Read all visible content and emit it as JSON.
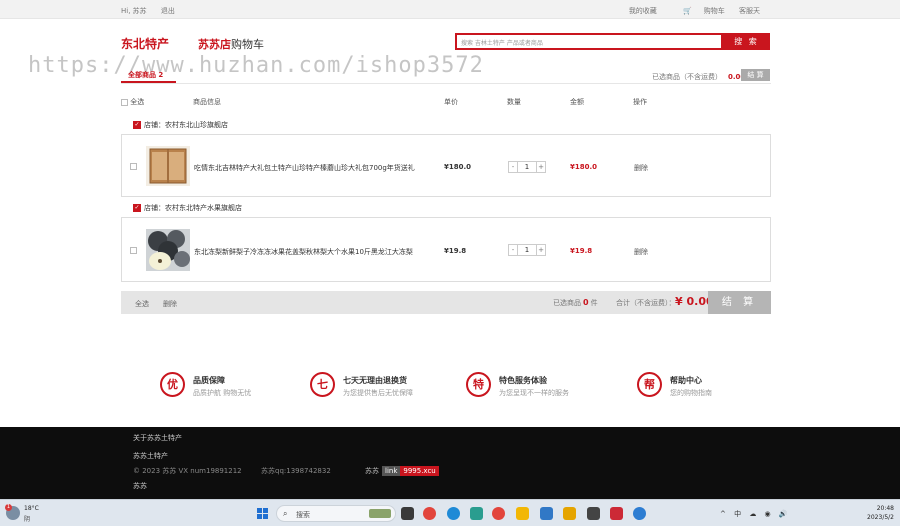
{
  "topbar": {
    "left": [
      "Hi, 苏苏",
      "退出"
    ],
    "right": [
      "我的收藏",
      "购物车",
      "客服天"
    ],
    "cart_icon": "cart-icon"
  },
  "header": {
    "logo_main": "东北特产",
    "logo_shop_bold": "苏苏店",
    "logo_shop_rest": "购物车",
    "search_placeholder": "搜索 吉林土特产 产品或者商品",
    "search_button": "搜 索"
  },
  "watermark": "https://www.huzhan.com/ishop3572",
  "cart": {
    "all_tab": "全部商品 2",
    "selected_label": "已选商品（不含运费）",
    "selected_amount": "0.00",
    "pay_small": "结 算",
    "columns": [
      "全选",
      "商品信息",
      "单价",
      "数量",
      "金额",
      "操作"
    ],
    "shops": [
      {
        "shop_label": "店铺：",
        "shop_name": "农村东北山珍旗舰店",
        "item": {
          "name": "吃情东北吉林特产大礼包土特产山珍特产榛蘑山珍大礼包700g年货送礼",
          "price": "¥180.0",
          "qty_minus": "-",
          "qty": "1",
          "qty_plus": "+",
          "subtotal": "¥180.0",
          "delete": "删除"
        }
      },
      {
        "shop_label": "店铺：",
        "shop_name": "农村东北特产水果旗舰店",
        "item": {
          "name": "东北冻梨新鲜梨子冷冻冻冰果花盖梨秋林梨大个水果10斤黑龙江大冻梨",
          "price": "¥19.8",
          "qty_minus": "-",
          "qty": "1",
          "qty_plus": "+",
          "subtotal": "¥19.8",
          "delete": "删除"
        }
      }
    ],
    "summary": {
      "select_all": "全选",
      "delete": "删除",
      "selected_prefix": "已选商品",
      "selected_count": "0",
      "selected_suffix": "件",
      "total_label": "合计（不含运费）：",
      "total": "¥ 0.00",
      "checkout": "结 算"
    }
  },
  "services": [
    {
      "icon": "优",
      "title": "品质保障",
      "sub": "品质护航 购物无忧"
    },
    {
      "icon": "七",
      "title": "七天无理由退换货",
      "sub": "为您提供售后无忧保障"
    },
    {
      "icon": "特",
      "title": "特色服务体验",
      "sub": "为您呈现不一样的服务"
    },
    {
      "icon": "帮",
      "title": "帮助中心",
      "sub": "您的购物指南"
    }
  ],
  "footer": {
    "line1": "关于苏苏土特产",
    "line2": "苏苏土特产",
    "copyright": "© 2023 苏苏 VX num19891212",
    "qq": "苏苏qq:1398742832",
    "link_prefix": "苏苏",
    "badge1": "link",
    "badge2": "9995.xcu",
    "line4": "苏苏"
  },
  "taskbar": {
    "temp": "18°C",
    "weather": "阴",
    "notify": "1",
    "search": "搜索",
    "time": "20:48",
    "date": "2023/5/2",
    "tray": "^ 中 ☁ ◉ 🔊"
  }
}
